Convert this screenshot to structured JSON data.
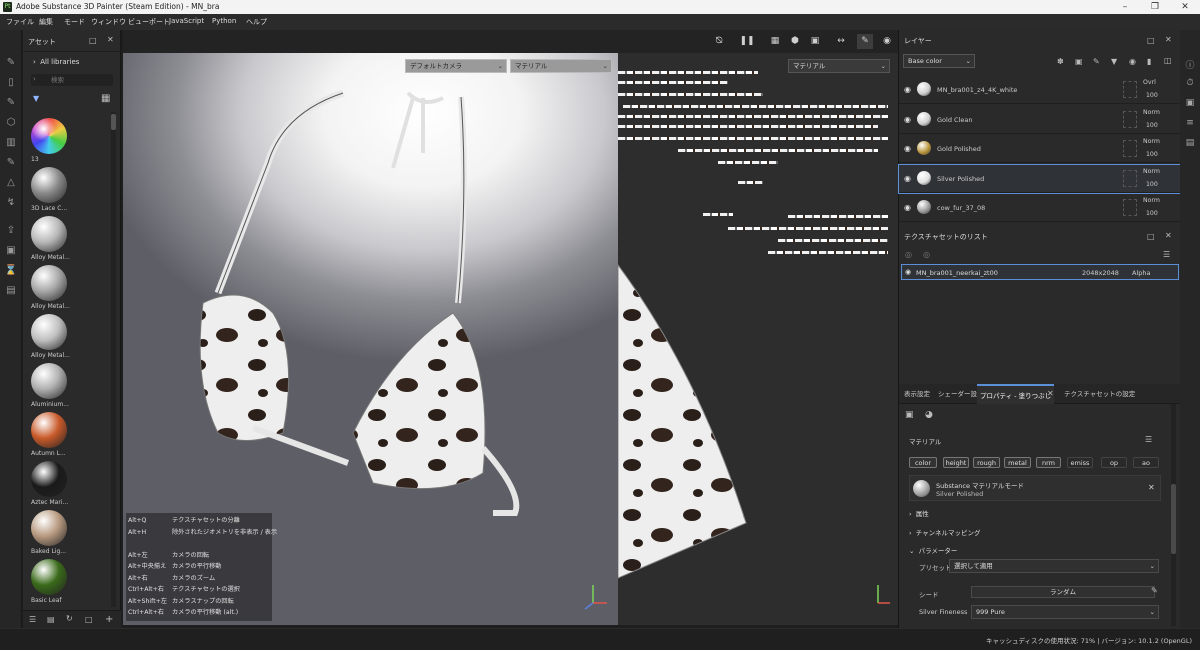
{
  "window": {
    "title": "Adobe Substance 3D Painter (Steam Edition) - MN_bra",
    "app_badge": "Pt"
  },
  "menu": [
    "ファイル",
    "編集",
    "モード",
    "ウィンドウ",
    "ビューポート",
    "JavaScript",
    "Python",
    "ヘルプ"
  ],
  "assets": {
    "title": "アセット",
    "library": "All libraries",
    "search_placeholder": "検索",
    "items": [
      {
        "label": "13",
        "color": "rainbow"
      },
      {
        "label": "3D Lace C...",
        "color": "#8a8a8a"
      },
      {
        "label": "Alloy Metal...",
        "color": "#b8b8b8"
      },
      {
        "label": "Alloy Metal...",
        "color": "#a8a8a8"
      },
      {
        "label": "Alloy Metal...",
        "color": "#c0c0c0"
      },
      {
        "label": "Aluminium...",
        "color": "#b0b0b0"
      },
      {
        "label": "Autumn L...",
        "color": "#c85a2a"
      },
      {
        "label": "Aztec Mari...",
        "color": "#1a1a1a"
      },
      {
        "label": "Baked Lig...",
        "color": "#b89a80"
      },
      {
        "label": "Basic Leaf",
        "color": "#3a6a1a"
      }
    ]
  },
  "viewport": {
    "camera_dropdown": "デフォルトカメラ",
    "material_dropdown": "マテリアル",
    "material_dropdown_2d": "マテリアル"
  },
  "shortcuts": [
    {
      "key": "Alt+Q",
      "desc": "テクスチャセットの分離"
    },
    {
      "key": "Alt+H",
      "desc": "除外されたジオメトリを非表示 / 表示"
    },
    {
      "key": "",
      "desc": ""
    },
    {
      "key": "Alt+左",
      "desc": "カメラの回転"
    },
    {
      "key": "Alt+中央揃え",
      "desc": "カメラの平行移動"
    },
    {
      "key": "Alt+右",
      "desc": "カメラのズーム"
    },
    {
      "key": "Ctrl+Alt+右",
      "desc": "テクスチャセットの選択"
    },
    {
      "key": "Alt+Shift+左",
      "desc": "カメラスナップの回転"
    },
    {
      "key": "Ctrl+Alt+右",
      "desc": "カメラの平行移動 (alt.)"
    }
  ],
  "layers": {
    "title": "レイヤー",
    "channel": "Base color",
    "rows": [
      {
        "name": "MN_bra001_z4_4K_white",
        "blend": "Ovrl",
        "opacity": "100",
        "thumb": "#cfcfcf"
      },
      {
        "name": "Gold Clean",
        "blend": "Norm",
        "opacity": "100",
        "thumb": "#d0d0d0"
      },
      {
        "name": "Gold Polished",
        "blend": "Norm",
        "opacity": "100",
        "thumb": "#b8953a"
      },
      {
        "name": "Silver Polished",
        "blend": "Norm",
        "opacity": "100",
        "thumb": "#e0e0e0"
      },
      {
        "name": "cow_fur_37_08",
        "blend": "Norm",
        "opacity": "100",
        "thumb": "#9a9a9a"
      }
    ]
  },
  "texture_sets": {
    "title": "テクスチャセットのリスト",
    "name": "MN_bra001_neerkai_zt00",
    "resolution": "2048x2048",
    "alpha": "Alpha"
  },
  "properties": {
    "tabs": [
      "表示設定",
      "シェーダー設定",
      "プロパティ - 塗りつぶし",
      "テクスチャセットの設定"
    ],
    "section_title": "マテリアル",
    "channels": [
      "color",
      "height",
      "rough",
      "metal",
      "nrm",
      "emiss",
      "op",
      "ao"
    ],
    "substance_mode": "Substance マテリアルモード",
    "material_name": "Silver Polished",
    "attributes": "属性",
    "channel_mapping": "チャンネルマッピング",
    "parameters": "パラメーター",
    "preset_label": "プリセット",
    "preset_value": "選択して適用",
    "seed_label": "シード",
    "seed_value": "ランダム",
    "fineness_label": "Silver Fineness",
    "fineness_value": "999 Pure"
  },
  "status": "キャッシュディスクの使用状況: 71% | バージョン: 10.1.2 (OpenGL)"
}
